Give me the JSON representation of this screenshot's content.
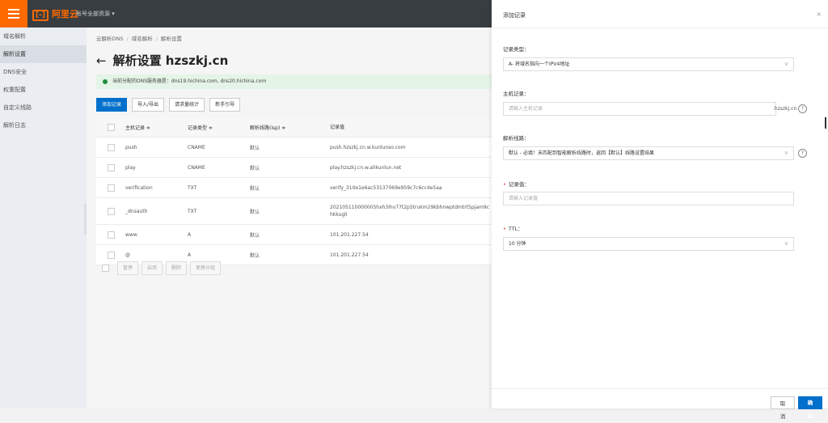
{
  "topbar": {
    "logo": "阿里云",
    "account": "账号全部资源 ▾"
  },
  "sidebar": {
    "items": [
      {
        "label": "域名解析"
      },
      {
        "label": "解析设置"
      },
      {
        "label": "DNS安全"
      },
      {
        "label": "权重配置"
      },
      {
        "label": "自定义线路"
      },
      {
        "label": "解析日志"
      }
    ]
  },
  "breadcrumb": [
    "云解析DNS",
    "域名解析",
    "解析设置"
  ],
  "page": {
    "title": "解析设置 hzszkj.cn",
    "back": "←"
  },
  "notice": "当前分配的DNS服务器是：dns19.hichina.com, dns20.hichina.com",
  "toolbar": {
    "add": "添加记录",
    "import": "导入/导出",
    "stats": "请求量统计",
    "guide": "新手引导"
  },
  "table": {
    "headers": {
      "host": "主机记录 ≑",
      "type": "记录类型 ≑",
      "line": "解析线路(isp) ≑",
      "value": "记录值"
    },
    "rows": [
      {
        "host": "push",
        "type": "CNAME",
        "line": "默认",
        "value": "push.hzszkj.cn.w.kunlunso.com"
      },
      {
        "host": "play",
        "type": "CNAME",
        "line": "默认",
        "value": "play.hzszkj.cn.w.alikunlun.net"
      },
      {
        "host": "verification",
        "type": "TXT",
        "line": "默认",
        "value": "verify_310e1e6ac53137069e959c7c6cc4e5aa"
      },
      {
        "host": "_dnsauth",
        "type": "TXT",
        "line": "默认",
        "value": "202105110000005hxh3ihv77t2p5trukm29kbhnwptdmtrt5pjam9chkkugli"
      },
      {
        "host": "www",
        "type": "A",
        "line": "默认",
        "value": "101.201.227.54"
      },
      {
        "host": "@",
        "type": "A",
        "line": "默认",
        "value": "101.201.227.54"
      }
    ]
  },
  "bulk": {
    "pause": "暂停",
    "enable": "启用",
    "delete": "删除",
    "group": "更换分组"
  },
  "drawer": {
    "title": "添加记录",
    "close": "×",
    "record_type_label": "记录类型：",
    "record_type_value": "A- 将域名指向一个IPV4地址",
    "host_label": "主机记录：",
    "host_placeholder": "请输入主机记录",
    "host_suffix": ".hzszkj.cn",
    "line_label": "解析线路：",
    "line_value": "默认 - 必填！未匹配到智能解析线路时，返回【默认】线路设置结果",
    "value_label": "记录值：",
    "value_placeholder": "请输入记录值",
    "ttl_label": "TTL：",
    "ttl_value": "10 分钟",
    "cancel": "取 消",
    "confirm": "确 认"
  }
}
